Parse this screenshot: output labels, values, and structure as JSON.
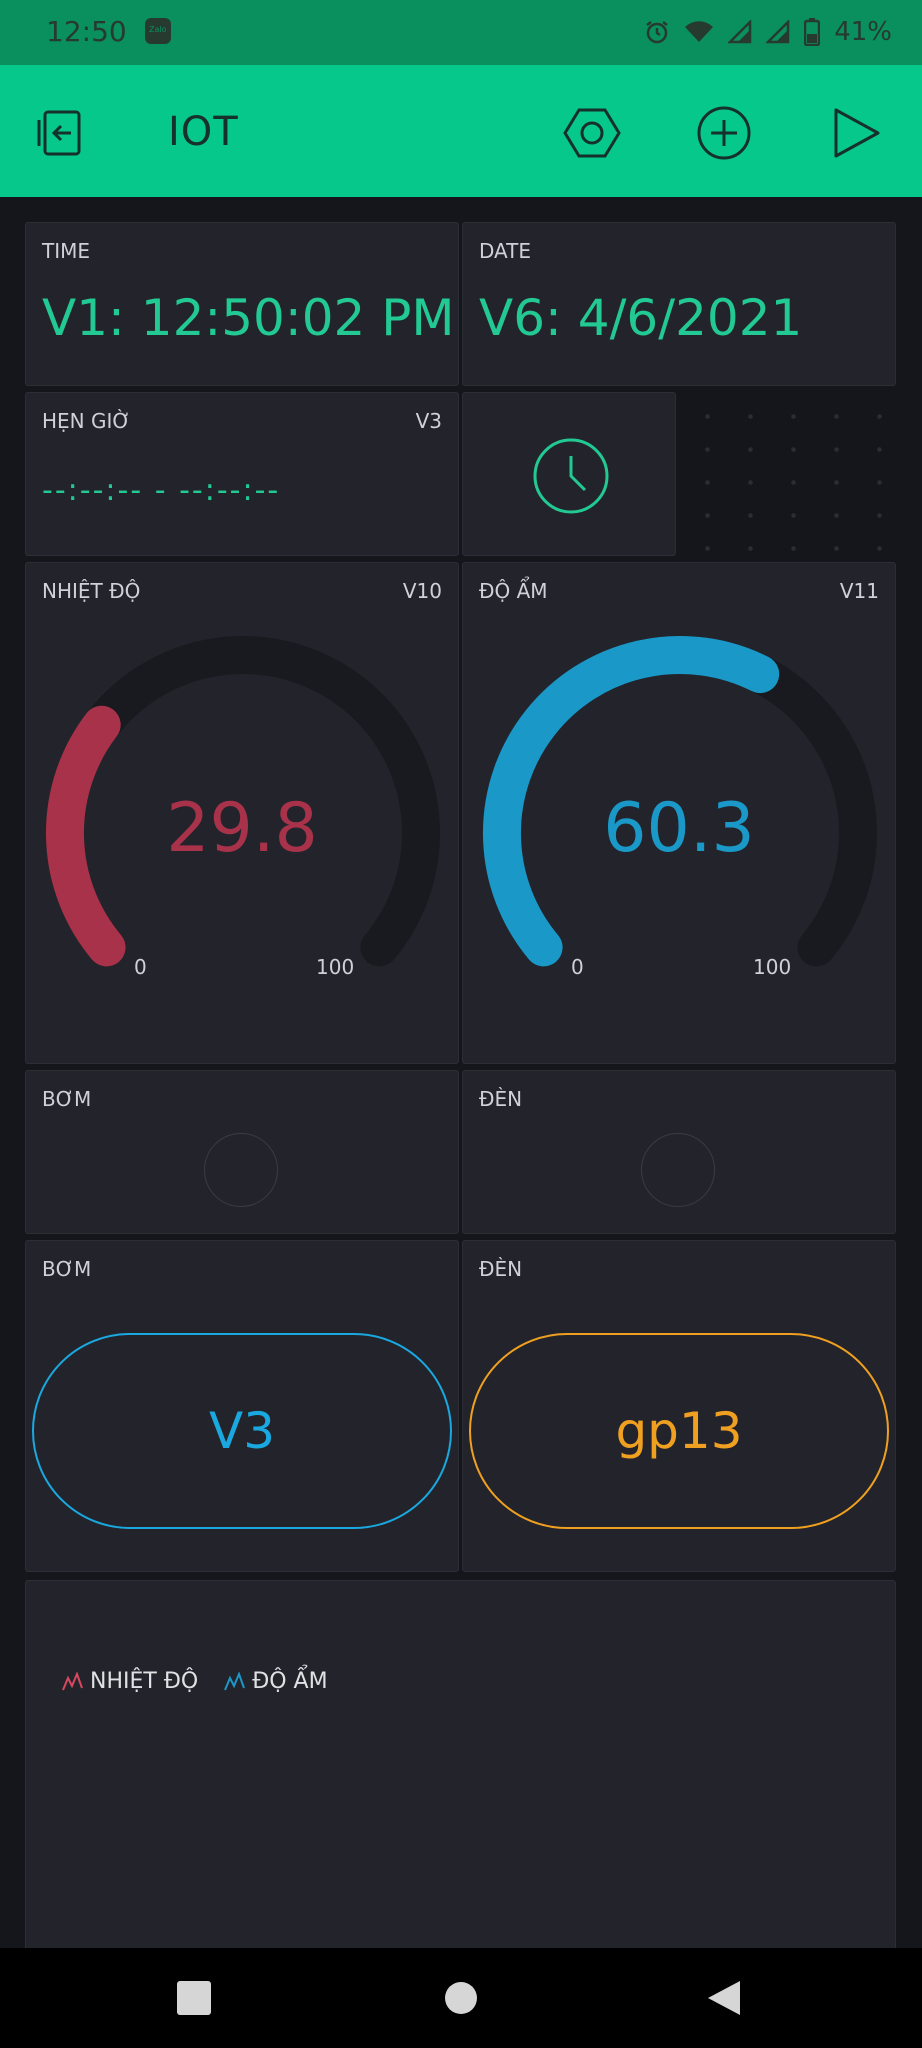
{
  "status_bar": {
    "time": "12:50",
    "app_badge": "Zalo",
    "battery": "41%",
    "icons": [
      "alarm-icon",
      "wifi-icon",
      "signal-icon",
      "signal-icon",
      "battery-icon"
    ]
  },
  "app_bar": {
    "title": "IOT",
    "icons": [
      "exit-icon",
      "settings-hex-icon",
      "add-circle-icon",
      "play-icon"
    ],
    "background": "#06c88a"
  },
  "widgets": {
    "time": {
      "label": "TIME",
      "value": "V1: 12:50:02 PM"
    },
    "date": {
      "label": "DATE",
      "value": "V6: 4/6/2021"
    },
    "timer": {
      "label": "HẸN GIỜ",
      "pin": "V3",
      "value": "--:--:-- - --:--:--"
    },
    "clock_widget": {
      "icon": "clock-icon"
    },
    "temperature": {
      "label": "NHIỆT ĐỘ",
      "pin": "V10",
      "value": "29.8",
      "min": "0",
      "max": "100",
      "fraction": 0.298,
      "color": "#a8324a"
    },
    "humidity": {
      "label": "ĐỘ ẨM",
      "pin": "V11",
      "value": "60.3",
      "min": "0",
      "max": "100",
      "fraction": 0.603,
      "color": "#1a98c8"
    },
    "led_pump": {
      "label": "BƠM"
    },
    "led_light": {
      "label": "ĐÈN"
    },
    "button_pump": {
      "label": "BƠM",
      "value": "V3",
      "color": "#1aa8e0"
    },
    "button_light": {
      "label": "ĐÈN",
      "value": "gp13",
      "color": "#f0a020"
    },
    "chart": {
      "legend": [
        {
          "name": "NHIỆT ĐỘ",
          "color": "#d8485e"
        },
        {
          "name": "ĐỘ ẨM",
          "color": "#1a98c8"
        }
      ]
    }
  },
  "nav_bar": {
    "icons": [
      "recents-icon",
      "home-icon",
      "back-icon"
    ]
  }
}
